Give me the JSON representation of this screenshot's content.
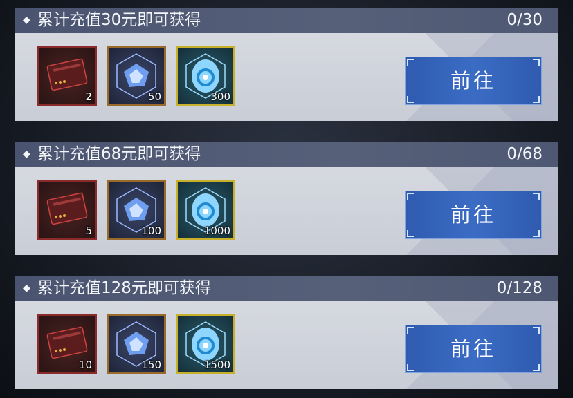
{
  "tasks": [
    {
      "title": "累计充值30元即可获得",
      "progress": "0/30",
      "rewards": [
        {
          "icon": "card-icon",
          "count": "2"
        },
        {
          "icon": "crystal-icon",
          "count": "50"
        },
        {
          "icon": "gem-icon",
          "count": "300"
        }
      ],
      "button_label": "前往"
    },
    {
      "title": "累计充值68元即可获得",
      "progress": "0/68",
      "rewards": [
        {
          "icon": "card-icon",
          "count": "5"
        },
        {
          "icon": "crystal-icon",
          "count": "100"
        },
        {
          "icon": "gem-icon",
          "count": "1000"
        }
      ],
      "button_label": "前往"
    },
    {
      "title": "累计充值128元即可获得",
      "progress": "0/128",
      "rewards": [
        {
          "icon": "card-icon",
          "count": "10"
        },
        {
          "icon": "crystal-icon",
          "count": "150"
        },
        {
          "icon": "gem-icon",
          "count": "1500"
        }
      ],
      "button_label": "前往"
    }
  ],
  "colors": {
    "header_bg": "#4e5872",
    "body_bg": "#d0d3da",
    "button_bg": "#3463b8",
    "card_border": "#8a2a2a",
    "crystal_border": "#9a6a2a",
    "gem_border": "#c8b02a"
  }
}
